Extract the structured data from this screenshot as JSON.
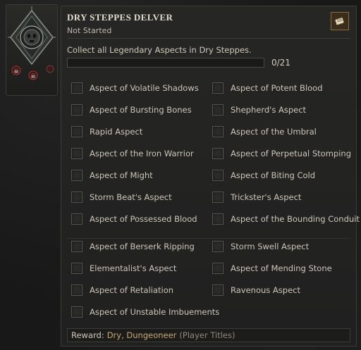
{
  "emblem": {
    "icon": "skull-diamond-emblem-icon"
  },
  "challenge": {
    "title": "DRY STEPPES DELVER",
    "status": "Not Started",
    "description": "Collect all Legendary Aspects in Dry Steppes.",
    "progress_text": "0/21",
    "progress_fraction": 0.0
  },
  "aspects_left": [
    "Aspect of Volatile Shadows",
    "Aspect of Bursting Bones",
    "Rapid Aspect",
    "Aspect of the Iron Warrior",
    "Aspect of Might",
    "Storm Beat's Aspect",
    "Aspect of Possessed Blood",
    "Aspect of Berserk Ripping",
    "Elementalist's Aspect",
    "Aspect of Retaliation",
    "Aspect of Unstable Imbuements"
  ],
  "aspects_right": [
    "Aspect of Potent Blood",
    "Shepherd's Aspect",
    "Aspect of the Umbral",
    "Aspect of Perpetual Stomping",
    "Aspect of Biting Cold",
    "Trickster's Aspect",
    "Aspect of the Bounding Conduit",
    "Storm Swell Aspect",
    "Aspect of Mending Stone",
    "Ravenous Aspect"
  ],
  "reward": {
    "label": "Reward:",
    "value": "Dry, Dungeoneer",
    "note": "(Player Titles)"
  },
  "colors": {
    "accent": "#c9a977",
    "progress_fill": "#8a6e45",
    "panel": "#242423"
  }
}
